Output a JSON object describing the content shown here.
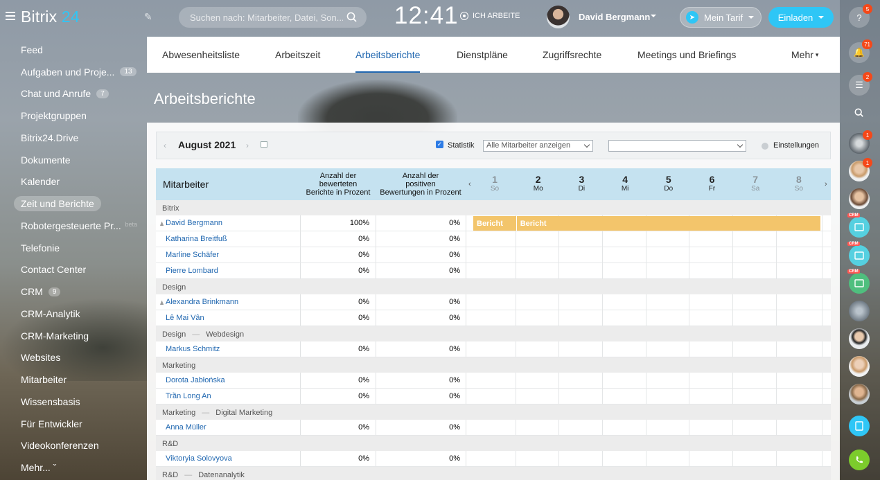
{
  "app": {
    "logo_name": "Bitrix",
    "logo_num": "24"
  },
  "header": {
    "search_placeholder": "Suchen nach: Mitarbeiter, Datei, Son...",
    "clock": "12:41",
    "work_status": "ICH ARBEITE",
    "user_name": "David Bergmann",
    "tarif_label": "Mein Tarif",
    "invite_label": "Einladen"
  },
  "sidebar": {
    "items": [
      {
        "label": "Feed"
      },
      {
        "label": "Aufgaben und Proje...",
        "count": "13"
      },
      {
        "label": "Chat und Anrufe",
        "count": "7"
      },
      {
        "label": "Projektgruppen"
      },
      {
        "label": "Bitrix24.Drive"
      },
      {
        "label": "Dokumente"
      },
      {
        "label": "Kalender"
      },
      {
        "label": "Zeit und Berichte",
        "active": true
      },
      {
        "label": "Robotergesteuerte Pr...",
        "tag": "beta"
      },
      {
        "label": "Telefonie"
      },
      {
        "label": "Contact Center"
      },
      {
        "label": "CRM",
        "count": "9"
      },
      {
        "label": "CRM-Analytik"
      },
      {
        "label": "CRM-Marketing"
      },
      {
        "label": "Websites"
      },
      {
        "label": "Mitarbeiter"
      },
      {
        "label": "Wissensbasis"
      },
      {
        "label": "Für Entwickler"
      },
      {
        "label": "Videokonferenzen"
      },
      {
        "label": "Mehr... ˇ"
      }
    ]
  },
  "rightbar": {
    "help_badge": "5",
    "notify_badge": "71",
    "chat_badge": "2",
    "ava1_badge": "1",
    "ava2_badge": "1",
    "crm_tag": "CRM"
  },
  "tabs": [
    {
      "label": "Abwesenheitsliste"
    },
    {
      "label": "Arbeitszeit"
    },
    {
      "label": "Arbeitsberichte",
      "active": true
    },
    {
      "label": "Dienstpläne"
    },
    {
      "label": "Zugriffsrechte"
    },
    {
      "label": "Meetings und Briefings"
    },
    {
      "label": "Mehr"
    }
  ],
  "page_title": "Arbeitsberichte",
  "toolbar": {
    "month": "August 2021",
    "stat_label": "Statistik",
    "employee_filter": "Alle Mitarbeiter anzeigen",
    "second_filter": "",
    "settings_label": "Einstellungen"
  },
  "table": {
    "col_employee": "Mitarbeiter",
    "col_rated_l1": "Anzahl der",
    "col_rated_l2": "bewerteten",
    "col_rated_l3": "Berichte in Prozent",
    "col_pos_l1": "Anzahl der",
    "col_pos_l2": "positiven",
    "col_pos_l3": "Bewertungen in Prozent",
    "days": [
      {
        "d": "1",
        "w": "So",
        "weekend": true
      },
      {
        "d": "2",
        "w": "Mo"
      },
      {
        "d": "3",
        "w": "Di"
      },
      {
        "d": "4",
        "w": "Mi"
      },
      {
        "d": "5",
        "w": "Do"
      },
      {
        "d": "6",
        "w": "Fr"
      },
      {
        "d": "7",
        "w": "Sa",
        "weekend": true
      },
      {
        "d": "8",
        "w": "So",
        "weekend": true
      }
    ],
    "rows": [
      {
        "type": "group",
        "dept": "Bitrix"
      },
      {
        "type": "emp",
        "name": "David Bergmann",
        "head": true,
        "v1": "100%",
        "v2": "0%",
        "report1": "Bericht",
        "report2": "Bericht"
      },
      {
        "type": "emp",
        "name": "Katharina Breitfuß",
        "v1": "0%",
        "v2": "0%"
      },
      {
        "type": "emp",
        "name": "Marline Schäfer",
        "v1": "0%",
        "v2": "0%"
      },
      {
        "type": "emp",
        "name": "Pierre Lombard",
        "v1": "0%",
        "v2": "0%"
      },
      {
        "type": "group",
        "dept": "Design"
      },
      {
        "type": "emp",
        "name": "Alexandra Brinkmann",
        "head": true,
        "v1": "0%",
        "v2": "0%"
      },
      {
        "type": "emp",
        "name": "Lê Mai Vân",
        "v1": "0%",
        "v2": "0%"
      },
      {
        "type": "group",
        "dept": "Design",
        "sub": "Webdesign"
      },
      {
        "type": "emp",
        "name": "Markus Schmitz",
        "v1": "0%",
        "v2": "0%"
      },
      {
        "type": "group",
        "dept": "Marketing"
      },
      {
        "type": "emp",
        "name": "Dorota Jabłońska",
        "v1": "0%",
        "v2": "0%"
      },
      {
        "type": "emp",
        "name": "Trần Long An",
        "v1": "0%",
        "v2": "0%"
      },
      {
        "type": "group",
        "dept": "Marketing",
        "sub": "Digital Marketing"
      },
      {
        "type": "emp",
        "name": "Anna Müller",
        "v1": "0%",
        "v2": "0%"
      },
      {
        "type": "group",
        "dept": "R&D"
      },
      {
        "type": "emp",
        "name": "Viktoryia Solovyova",
        "v1": "0%",
        "v2": "0%"
      },
      {
        "type": "group",
        "dept": "R&D",
        "sub": "Datenanalytik"
      }
    ]
  }
}
